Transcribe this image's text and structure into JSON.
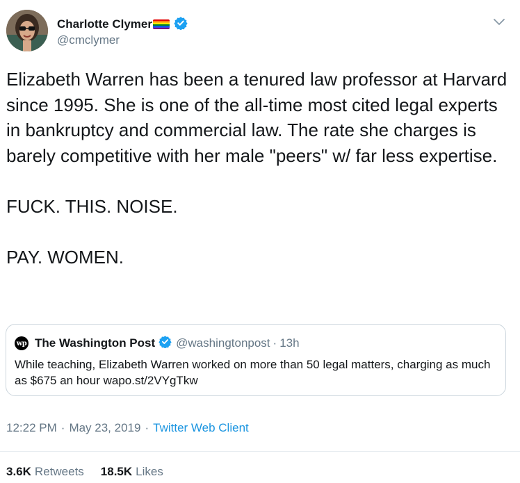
{
  "author": {
    "display_name": "Charlotte Clymer",
    "handle": "@cmclymer",
    "avatar_icon": "user-avatar",
    "badge_icon": "rainbow-flag-icon",
    "verified_icon": "verified-badge-icon"
  },
  "menu_icon": "chevron-down-icon",
  "tweet": {
    "paragraphs": [
      "Elizabeth Warren has been a tenured law professor at Harvard since 1995. She is one of the all-time most cited legal experts in bankruptcy and commercial law. The rate she charges is barely competitive with her male \"peers\" w/ far less expertise.",
      "FUCK. THIS. NOISE.",
      "PAY. WOMEN."
    ]
  },
  "quote": {
    "logo_text": "wp",
    "name": "The Washington Post",
    "handle": "@washingtonpost",
    "separator": "·",
    "time": "13h",
    "text": "While teaching, Elizabeth Warren worked on more than 50 legal matters, charging as much as $675 an hour wapo.st/2VYgTkw"
  },
  "meta": {
    "time": "12:22 PM",
    "dot1": "·",
    "date": "May 23, 2019",
    "dot2": "·",
    "source": "Twitter Web Client"
  },
  "stats": {
    "retweets_count": "3.6K",
    "retweets_label": "Retweets",
    "likes_count": "18.5K",
    "likes_label": "Likes"
  },
  "colors": {
    "link": "#1b95e0",
    "muted": "#657786",
    "verified": "#1da1f2",
    "border": "#ccd6dd"
  }
}
